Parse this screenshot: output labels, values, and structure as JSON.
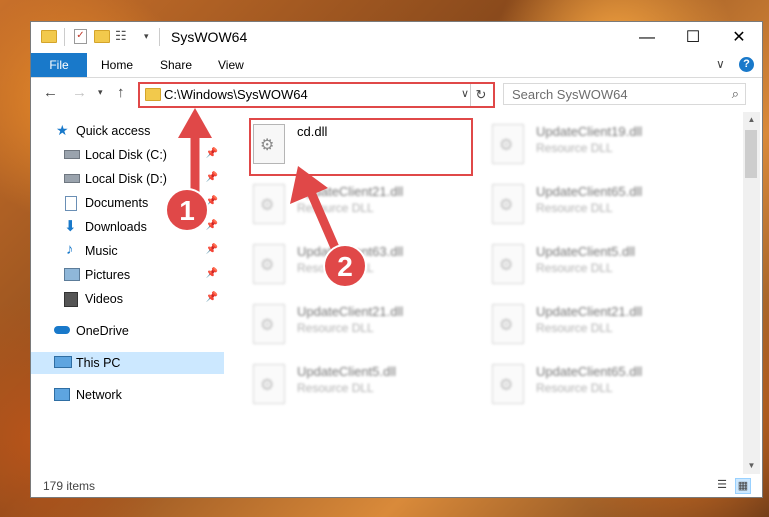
{
  "window": {
    "title": "SysWOW64",
    "controls": {
      "minimize": "—",
      "maximize": "☐",
      "close": "✕"
    }
  },
  "ribbon": {
    "file": "File",
    "tabs": [
      "Home",
      "Share",
      "View"
    ],
    "help": "?",
    "expand": "∨"
  },
  "address": {
    "path": "C:\\Windows\\SysWOW64",
    "search_placeholder": "Search SysWOW64"
  },
  "nav": {
    "quick_access": "Quick access",
    "items": [
      {
        "label": "Local Disk (C:)",
        "icon": "drive-icon",
        "pinned": true
      },
      {
        "label": "Local Disk (D:)",
        "icon": "drive-icon",
        "pinned": true
      },
      {
        "label": "Documents",
        "icon": "documents-icon",
        "pinned": true
      },
      {
        "label": "Downloads",
        "icon": "downloads-icon",
        "pinned": true
      },
      {
        "label": "Music",
        "icon": "music-icon",
        "pinned": true
      },
      {
        "label": "Pictures",
        "icon": "pictures-icon",
        "pinned": true
      },
      {
        "label": "Videos",
        "icon": "videos-icon",
        "pinned": true
      }
    ],
    "onedrive": "OneDrive",
    "this_pc": "This PC",
    "network": "Network"
  },
  "files": {
    "highlighted": {
      "name": "cd.dll",
      "type": ""
    },
    "left_column": [
      {
        "name": "UpdateClient21.dll",
        "type": "Resource DLL"
      },
      {
        "name": "UpdateClient63.dll",
        "type": "Resource DLL"
      },
      {
        "name": "UpdateClient21.dll",
        "type": "Resource DLL"
      },
      {
        "name": "UpdateClient5.dll",
        "type": "Resource DLL"
      }
    ],
    "right_column": [
      {
        "name": "UpdateClient19.dll",
        "type": "Resource DLL"
      },
      {
        "name": "UpdateClient65.dll",
        "type": "Resource DLL"
      },
      {
        "name": "UpdateClient5.dll",
        "type": "Resource DLL"
      },
      {
        "name": "UpdateClient21.dll",
        "type": "Resource DLL"
      },
      {
        "name": "UpdateClient65.dll",
        "type": "Resource DLL"
      }
    ]
  },
  "status": {
    "item_count": "179 items"
  },
  "annotations": {
    "badge_1": "1",
    "badge_2": "2",
    "color": "#e04848"
  }
}
